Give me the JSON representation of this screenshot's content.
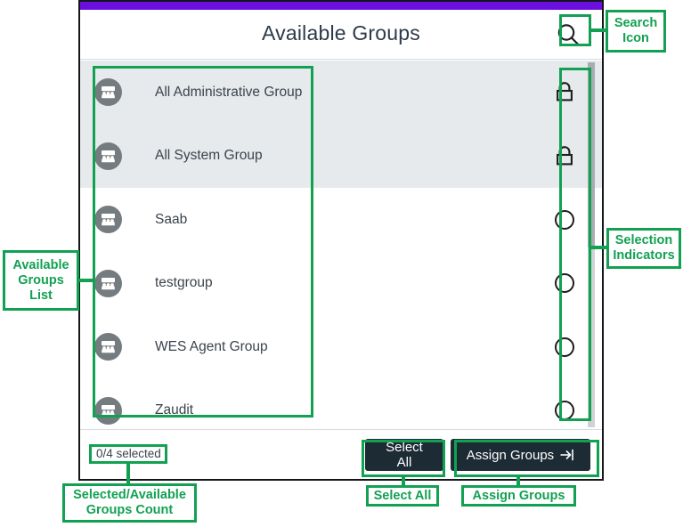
{
  "panel": {
    "title": "Available Groups",
    "accent_color": "#6a0fdd",
    "search_icon": "search-icon"
  },
  "list": {
    "rows": [
      {
        "name": "All Administrative Group",
        "indicator": "lock-icon",
        "locked": true,
        "icon": "group-avatar-icon"
      },
      {
        "name": "All System Group",
        "indicator": "lock-icon",
        "locked": true,
        "icon": "group-avatar-icon"
      },
      {
        "name": "Saab",
        "indicator": "radio-unchecked",
        "locked": false,
        "icon": "group-avatar-icon"
      },
      {
        "name": "testgroup",
        "indicator": "radio-unchecked",
        "locked": false,
        "icon": "group-avatar-icon"
      },
      {
        "name": "WES Agent Group",
        "indicator": "radio-unchecked",
        "locked": false,
        "icon": "group-avatar-icon"
      },
      {
        "name": "Zaudit",
        "indicator": "radio-unchecked",
        "locked": false,
        "icon": "group-avatar-icon"
      }
    ]
  },
  "footer": {
    "selected_count": "0/4 selected",
    "select_all_label": "Select All",
    "assign_groups_label": "Assign Groups",
    "assign_groups_icon": "arrow-to-bar-icon",
    "button_color": "#1d2b35"
  },
  "annotations": {
    "color": "#12a152",
    "items": [
      {
        "id": "search-icon",
        "label": "Search Icon"
      },
      {
        "id": "selection-indicators",
        "label": "Selection\nIndicators",
        "line1": "Selection",
        "line2": "Indicators"
      },
      {
        "id": "available-groups-list",
        "line1": "Available",
        "line2": "Groups",
        "line3": "List"
      },
      {
        "id": "selected-available-count",
        "line1": "Selected/Available",
        "line2": "Groups Count"
      },
      {
        "id": "select-all",
        "label": "Select All"
      },
      {
        "id": "assign-groups",
        "label": "Assign Groups"
      }
    ]
  }
}
